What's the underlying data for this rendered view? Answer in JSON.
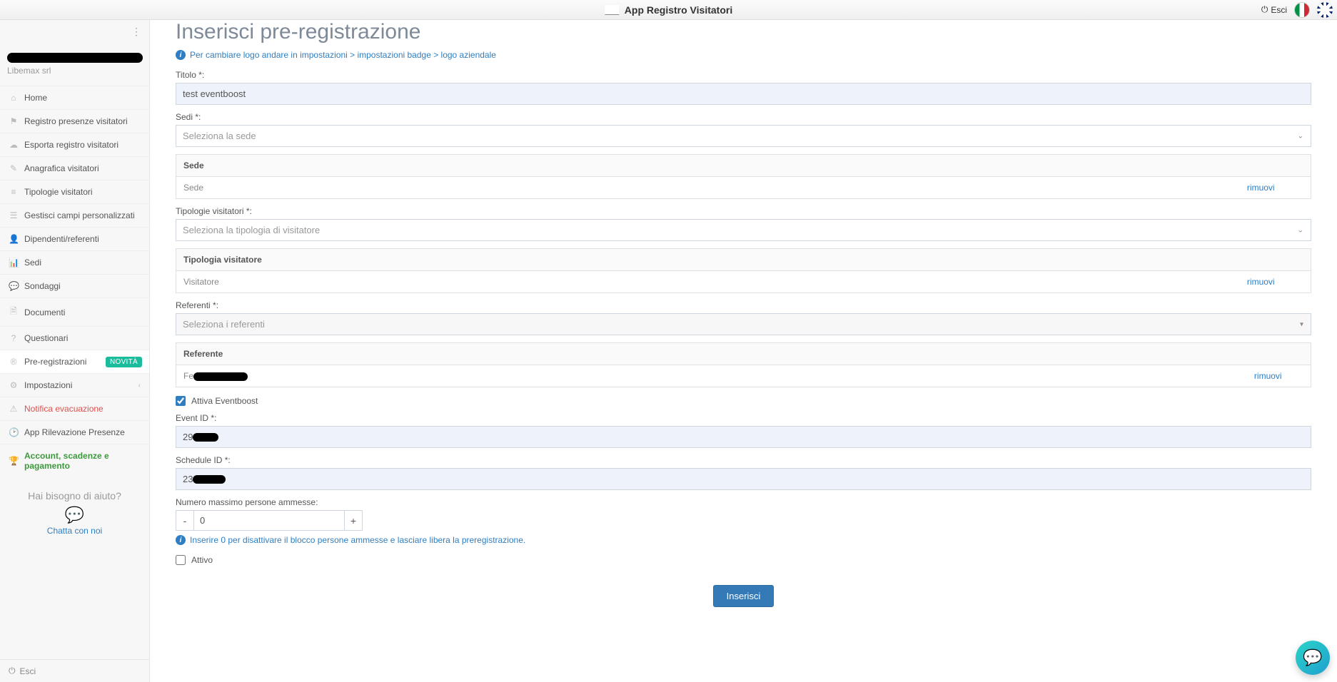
{
  "topbar": {
    "title": "App Registro Visitatori",
    "exit_label": "Esci"
  },
  "sidebar": {
    "company": "Libemax srl",
    "items": [
      {
        "icon": "⌂",
        "label": "Home"
      },
      {
        "icon": "⚑",
        "label": "Registro presenze visitatori"
      },
      {
        "icon": "☁",
        "label": "Esporta registro visitatori"
      },
      {
        "icon": "✎",
        "label": "Anagrafica visitatori"
      },
      {
        "icon": "≡",
        "label": "Tipologie visitatori"
      },
      {
        "icon": "☰",
        "label": "Gestisci campi personalizzati"
      },
      {
        "icon": "👤",
        "label": "Dipendenti/referenti"
      },
      {
        "icon": "📊",
        "label": "Sedi"
      },
      {
        "icon": "💬",
        "label": "Sondaggi"
      },
      {
        "icon": "🗎",
        "label": "Documenti"
      },
      {
        "icon": "?",
        "label": "Questionari"
      },
      {
        "icon": "®",
        "label": "Pre-registrazioni",
        "badge": "NOVITÀ",
        "active": true
      },
      {
        "icon": "⚙",
        "label": "Impostazioni",
        "chev": true
      },
      {
        "icon": "⚠",
        "label": "Notifica evacuazione",
        "red": true
      },
      {
        "icon": "🕑",
        "label": "App Rilevazione Presenze"
      },
      {
        "icon": "🏆",
        "label": "Account, scadenze e pagamento",
        "green": true
      }
    ],
    "help_title": "Hai bisogno di aiuto?",
    "help_link": "Chatta con noi",
    "footer_exit": "Esci"
  },
  "page": {
    "title": "Inserisci pre-registrazione",
    "info": "Per cambiare logo andare in impostazioni > impostazioni badge > logo aziendale",
    "labels": {
      "titolo": "Titolo *:",
      "sedi": "Sedi *:",
      "tipologie": "Tipologie visitatori *:",
      "referenti": "Referenti *:",
      "eventid": "Event ID *:",
      "scheduleid": "Schedule ID *:",
      "numero": "Numero massimo persone ammesse:"
    },
    "values": {
      "titolo": "test eventboost",
      "sede_ph": "Seleziona la sede",
      "tipologia_ph": "Seleziona la tipologia di visitatore",
      "referenti_ph": "Seleziona i referenti",
      "eventid_prefix": "29",
      "scheduleid_prefix": "23",
      "numero": "0"
    },
    "tables": {
      "sede_hdr": "Sede",
      "sede_val": "Sede",
      "tip_hdr": "Tipologia visitatore",
      "tip_val": "Visitatore",
      "ref_hdr": "Referente",
      "ref_val_prefix": "Fe",
      "remove": "rimuovi"
    },
    "checks": {
      "attiva": "Attiva Eventboost",
      "attivo": "Attivo"
    },
    "hint": "Inserire 0 per disattivare il blocco persone ammesse e lasciare libera la preregistrazione.",
    "submit": "Inserisci"
  }
}
